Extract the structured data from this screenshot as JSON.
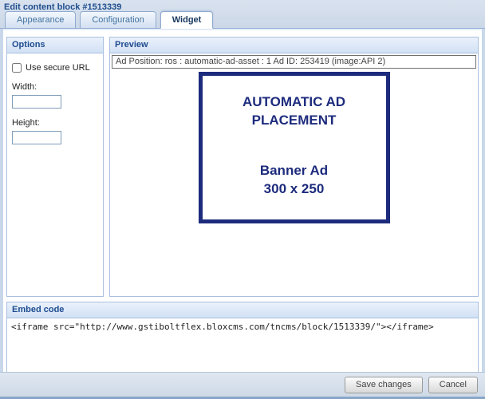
{
  "window": {
    "title": "Edit content block #1513339"
  },
  "tabs": [
    {
      "label": "Appearance",
      "active": false
    },
    {
      "label": "Configuration",
      "active": false
    },
    {
      "label": "Widget",
      "active": true
    }
  ],
  "options_panel": {
    "title": "Options",
    "secure_url_label": "Use secure URL",
    "secure_url_checked": false,
    "width_label": "Width:",
    "width_value": "",
    "height_label": "Height:",
    "height_value": ""
  },
  "preview_panel": {
    "title": "Preview",
    "ad_position": "Ad Position: ros : automatic-ad-asset : 1 Ad ID: 253419 (image:API 2)",
    "banner": {
      "line1": "AUTOMATIC AD",
      "line2": "PLACEMENT",
      "line3": "Banner Ad",
      "line4": "300 x 250"
    }
  },
  "embed_panel": {
    "title": "Embed code",
    "code": "<iframe src=\"http://www.gstiboltflex.bloxcms.com/tncms/block/1513339/\"></iframe>"
  },
  "footer": {
    "save_label": "Save changes",
    "cancel_label": "Cancel"
  },
  "colors": {
    "title_text": "#1f4e8c",
    "panel_header_text": "#1e4c8f",
    "banner_navy": "#1d2b7d",
    "panel_border": "#a9c0e0"
  }
}
